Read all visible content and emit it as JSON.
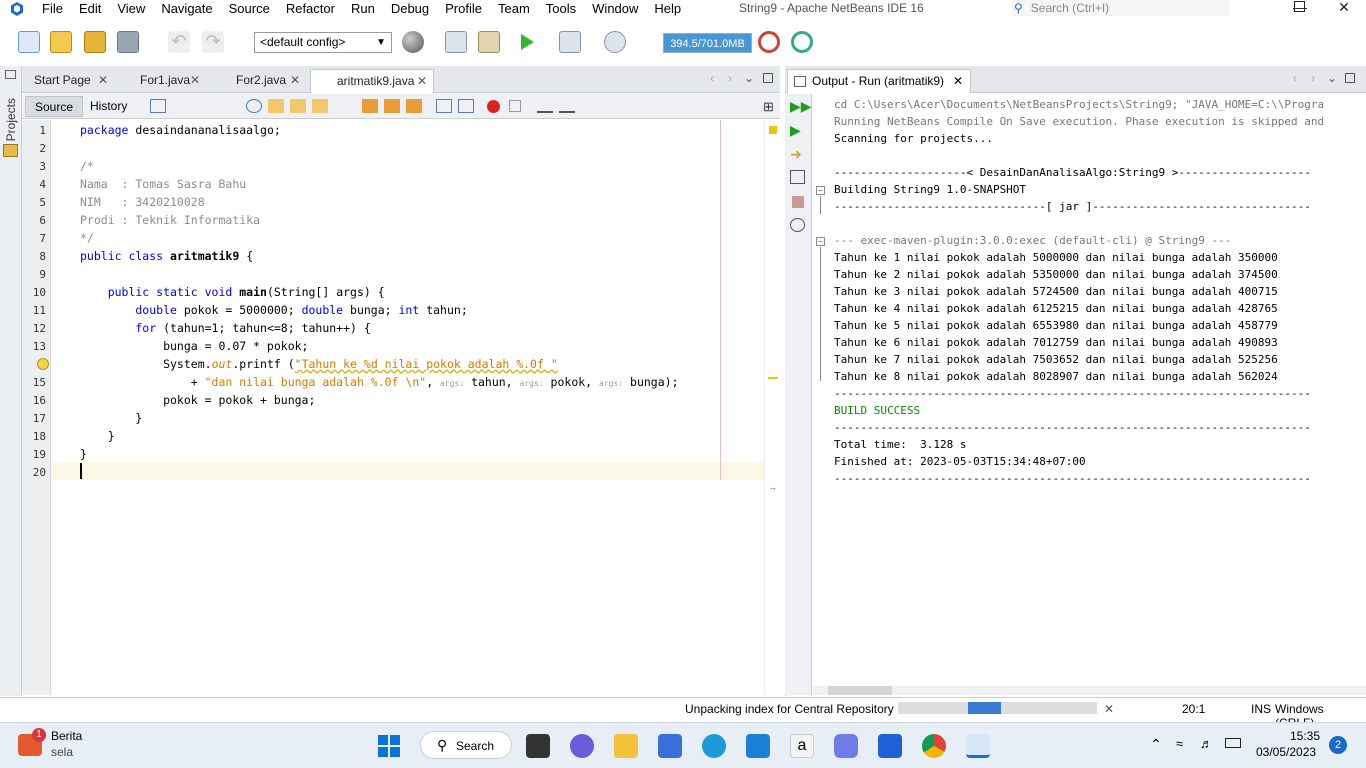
{
  "menu": [
    "File",
    "Edit",
    "View",
    "Navigate",
    "Source",
    "Refactor",
    "Run",
    "Debug",
    "Profile",
    "Team",
    "Tools",
    "Window",
    "Help"
  ],
  "window_title": "String9 - Apache NetBeans IDE 16",
  "search_placeholder": "Search (Ctrl+I)",
  "toolbar": {
    "config": "<default config>",
    "memory": "394.5/701.0MB"
  },
  "left_strip": {
    "projects": "Projects"
  },
  "editor_tabs": [
    {
      "label": "Start Page"
    },
    {
      "label": "For1.java"
    },
    {
      "label": "For2.java"
    },
    {
      "label": "aritmatik9.java"
    }
  ],
  "editor_toolbar": {
    "source": "Source",
    "history": "History"
  },
  "line_numbers": [
    "1",
    "2",
    "3",
    "4",
    "5",
    "6",
    "7",
    "8",
    "9",
    "10",
    "11",
    "12",
    "13",
    "14",
    "15",
    "16",
    "17",
    "18",
    "19",
    "20"
  ],
  "code": {
    "l1a": "package",
    "l1b": " desaindananalisaalgo;",
    "l3": "/*",
    "l4": "Nama  : Tomas Sasra Bahu",
    "l5": "NIM   : 3420210028",
    "l6": "Prodi : Teknik Informatika",
    "l7": "*/",
    "l8a": "public class",
    "l8b": " aritmatik9",
    "l8c": " {",
    "l10a": "    public static void",
    "l10b": " main",
    "l10c": "(String[] args) {",
    "l11a": "        double",
    "l11b": " pokok = 5000000; ",
    "l11c": "double",
    "l11d": " bunga; ",
    "l11e": "int",
    "l11f": " tahun;",
    "l12a": "        for",
    "l12b": " (tahun=1; tahun<=8; tahun++) {",
    "l13": "            bunga = 0.07 * pokok;",
    "l14a": "            System.",
    "l14b": "out",
    "l14c": ".printf (",
    "l14d": "\"Tahun ke %d nilai pokok adalah %.0f \"",
    "l15a": "                + ",
    "l15b": "\"dan nilai bunga adalah %.0f \\n\"",
    "l15c": ", ",
    "l15h": "args:",
    "l15d": " tahun, ",
    "l15e": " pokok, ",
    "l15f": " bunga);",
    "l16": "            pokok = pokok + bunga;",
    "l17": "        }",
    "l18": "    }",
    "l19": "}"
  },
  "output": {
    "tab_label": "Output - Run (aritmatik9)",
    "lines": [
      "cd C:\\Users\\Acer\\Documents\\NetBeansProjects\\String9; \"JAVA_HOME=C:\\\\Progra",
      "Running NetBeans Compile On Save execution. Phase execution is skipped and",
      "Scanning for projects...",
      "",
      "--------------------< DesainDanAnalisaAlgo:String9 >--------------------",
      "Building String9 1.0-SNAPSHOT",
      "--------------------------------[ jar ]---------------------------------",
      "",
      "--- exec-maven-plugin:3.0.0:exec (default-cli) @ String9 ---",
      "Tahun ke 1 nilai pokok adalah 5000000 dan nilai bunga adalah 350000",
      "Tahun ke 2 nilai pokok adalah 5350000 dan nilai bunga adalah 374500",
      "Tahun ke 3 nilai pokok adalah 5724500 dan nilai bunga adalah 400715",
      "Tahun ke 4 nilai pokok adalah 6125215 dan nilai bunga adalah 428765",
      "Tahun ke 5 nilai pokok adalah 6553980 dan nilai bunga adalah 458779",
      "Tahun ke 6 nilai pokok adalah 7012759 dan nilai bunga adalah 490893",
      "Tahun ke 7 nilai pokok adalah 7503652 dan nilai bunga adalah 525256",
      "Tahun ke 8 nilai pokok adalah 8028907 dan nilai bunga adalah 562024",
      "------------------------------------------------------------------------",
      "BUILD SUCCESS",
      "------------------------------------------------------------------------",
      "Total time:  3.128 s",
      "Finished at: 2023-05-03T15:34:48+07:00",
      "------------------------------------------------------------------------"
    ]
  },
  "status": {
    "task": "Unpacking index for Central Repository",
    "progress": 0.35,
    "position": "20:1",
    "mode": "INS",
    "line_ending": "Windows (CRLF)"
  },
  "taskbar": {
    "news_title": "Berita",
    "news_sub": "sela",
    "news_badge": "1",
    "search": "Search",
    "time": "15:35",
    "date": "03/05/2023",
    "notif": "2"
  },
  "colors": {
    "accent": "#3a7bd5",
    "keyword": "#0000e6",
    "string": "#ce7b00",
    "comment": "#8c8c8c"
  }
}
